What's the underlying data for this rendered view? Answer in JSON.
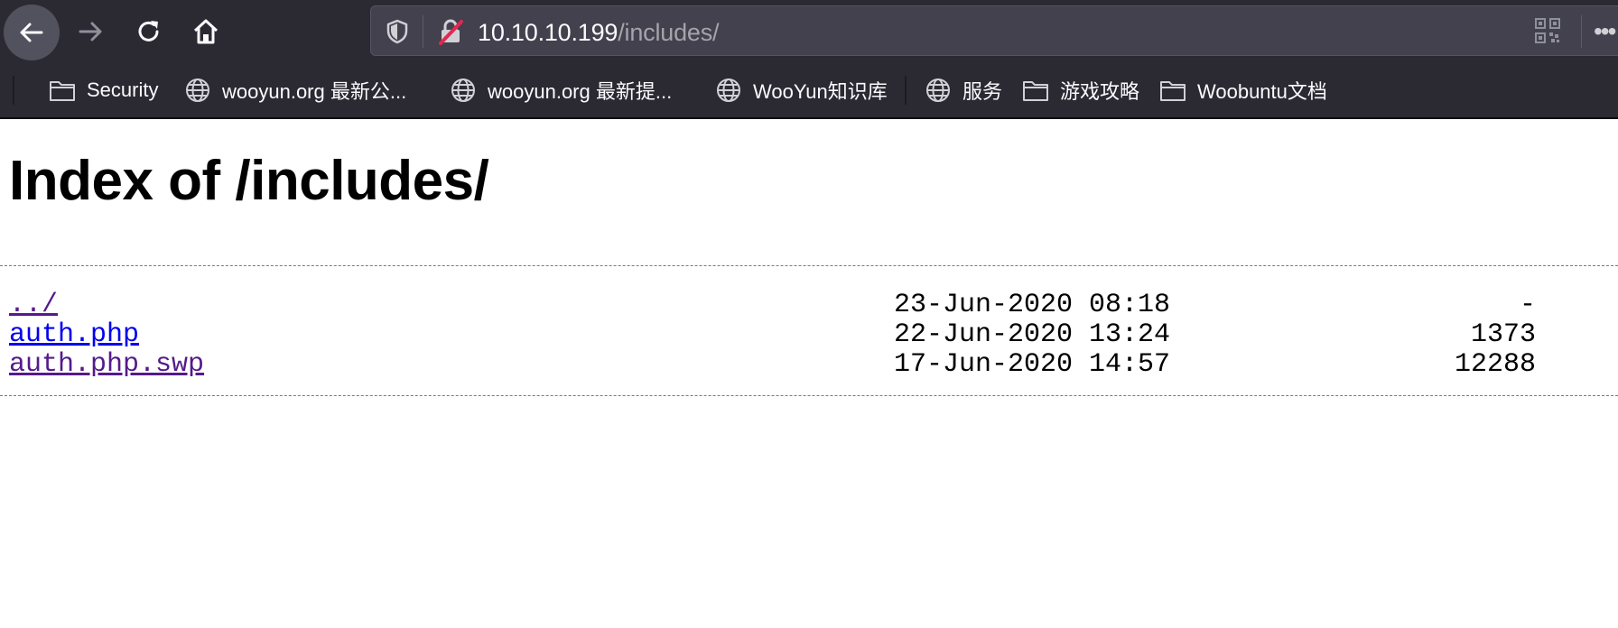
{
  "browser": {
    "url_host": "10.10.10.199",
    "url_path": "/includes/",
    "bookmarks": [
      {
        "label": "Security",
        "icon": "folder-icon"
      },
      {
        "label": "wooyun.org 最新公...",
        "icon": "globe-icon"
      },
      {
        "label": "wooyun.org 最新提...",
        "icon": "globe-icon"
      },
      {
        "label": "WooYun知识库",
        "icon": "globe-icon"
      },
      {
        "label": "服务",
        "icon": "globe-icon"
      },
      {
        "label": "游戏攻略",
        "icon": "folder-icon"
      },
      {
        "label": "Woobuntu文档",
        "icon": "folder-icon"
      }
    ],
    "colors": {
      "chrome_bg": "#2b2a33",
      "urlbar_bg": "#42414d",
      "lock_slash": "#e22850"
    }
  },
  "page": {
    "title": "Index of /includes/",
    "entries": [
      {
        "name": "../",
        "date": "23-Jun-2020 08:18",
        "size": "-",
        "visited": true
      },
      {
        "name": "auth.php",
        "date": "22-Jun-2020 13:24",
        "size": "1373",
        "visited": false
      },
      {
        "name": "auth.php.swp",
        "date": "17-Jun-2020 14:57",
        "size": "12288",
        "visited": true
      }
    ],
    "colors": {
      "link": "#0000ee",
      "visited_link": "#551a8b"
    }
  }
}
